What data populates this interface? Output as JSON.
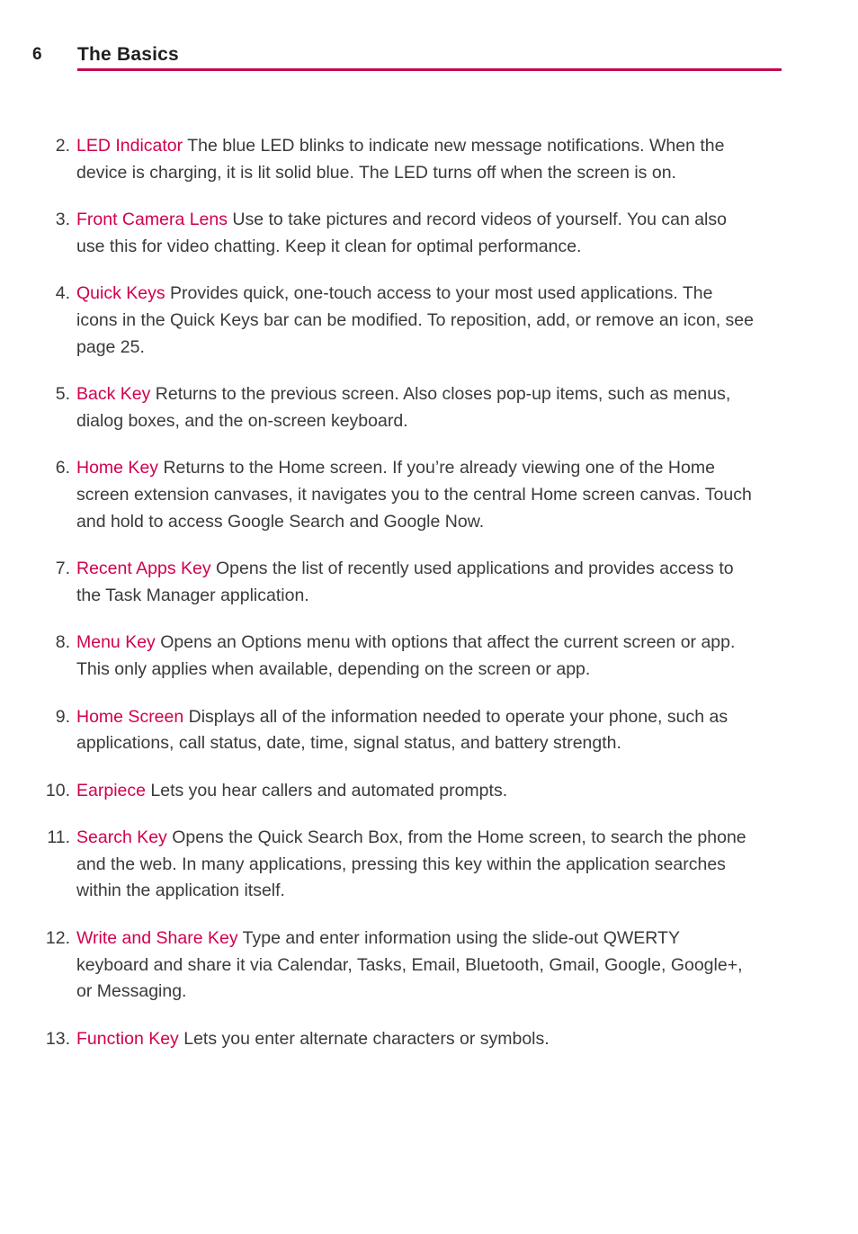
{
  "header": {
    "page_number": "6",
    "title": "The Basics",
    "rule_color": "#c4024f"
  },
  "colors": {
    "term": "#d1004f",
    "body_text": "#3a3a3a",
    "heading_text": "#1f1f1f",
    "background": "#ffffff"
  },
  "content": {
    "items": [
      {
        "number": "2.",
        "term": "LED Indicator",
        "description": " The blue LED blinks to indicate new message notifications. When the device is charging, it is lit solid blue. The LED turns off when the screen is on."
      },
      {
        "number": "3.",
        "term": "Front Camera Lens",
        "description": " Use to take pictures and record videos of yourself. You can also use this for video chatting. Keep it clean for optimal performance."
      },
      {
        "number": "4.",
        "term": "Quick Keys",
        "description": " Provides quick, one-touch access to your most used applications. The icons in the Quick Keys bar can be modified. To reposition, add, or remove an icon, see page 25."
      },
      {
        "number": "5.",
        "term": "Back Key",
        "description": " Returns to the previous screen. Also closes pop-up items, such as menus, dialog boxes, and the on-screen keyboard."
      },
      {
        "number": "6.",
        "term": "Home Key",
        "description": " Returns to the Home screen. If you’re already viewing one of the Home screen extension canvases, it navigates you to the central Home screen canvas. Touch and hold to access Google Search and Google Now."
      },
      {
        "number": "7.",
        "term": "Recent Apps Key",
        "description": " Opens the list of recently used applications and provides access to the Task Manager application."
      },
      {
        "number": "8.",
        "term": "Menu Key",
        "description": " Opens an Options menu with options that affect the current screen or app. This only applies when available, depending on the screen or app."
      },
      {
        "number": "9.",
        "term": "Home Screen",
        "description": " Displays all of the information needed to operate your phone, such as applications, call status, date, time, signal status, and battery strength."
      },
      {
        "number": "10.",
        "term": "Earpiece",
        "description": " Lets you hear callers and automated prompts."
      },
      {
        "number": "11.",
        "term": "Search Key",
        "description": " Opens the Quick Search Box, from the Home screen, to search the phone and the web. In many applications, pressing this key within the application searches within the application itself."
      },
      {
        "number": "12.",
        "term": "Write and Share Key",
        "description": " Type and enter information using the slide-out QWERTY keyboard and share it via Calendar, Tasks, Email, Bluetooth, Gmail, Google, Google+, or Messaging."
      },
      {
        "number": "13.",
        "term": "Function Key",
        "description": " Lets you enter alternate characters or symbols."
      }
    ]
  }
}
